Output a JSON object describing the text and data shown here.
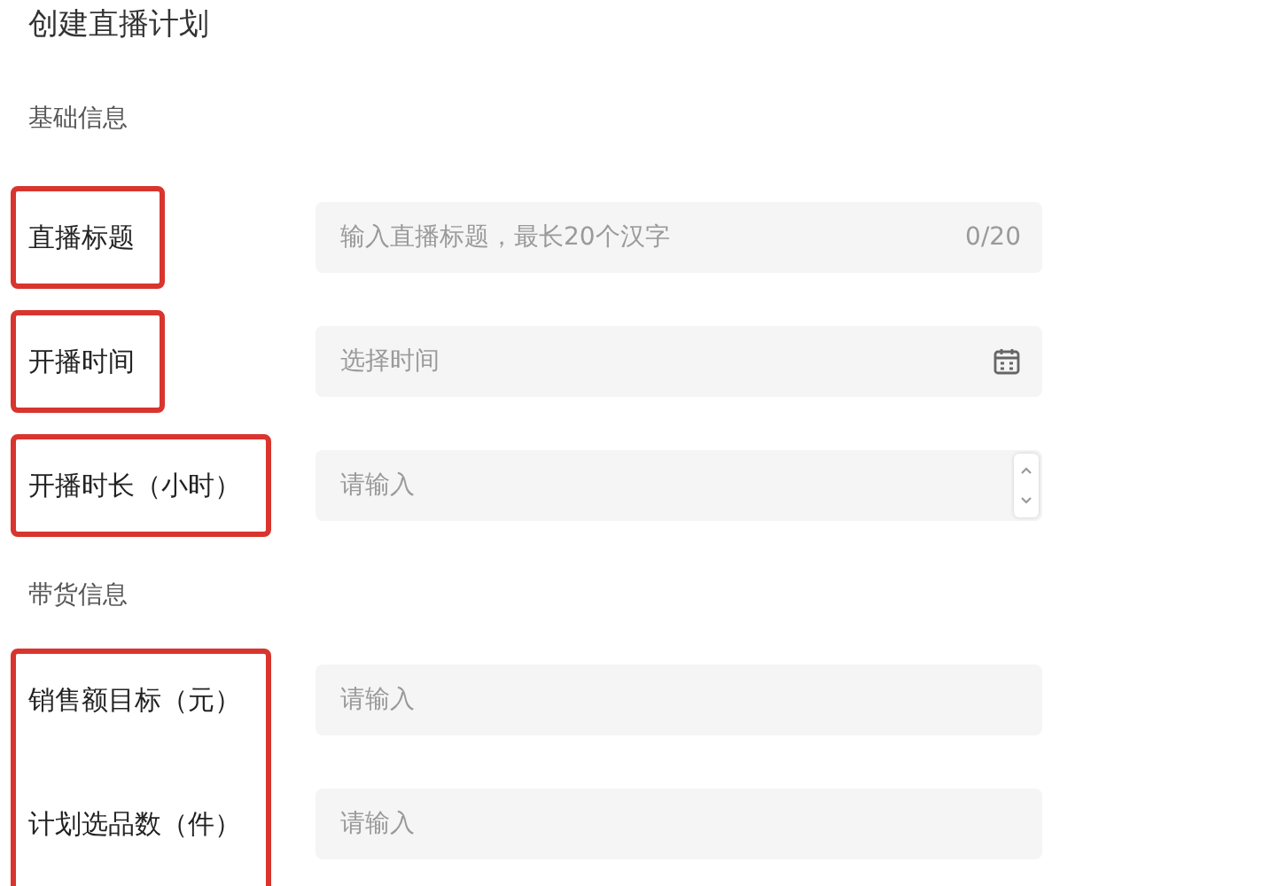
{
  "page": {
    "title": "创建直播计划"
  },
  "sections": [
    {
      "title": "基础信息",
      "groups": [
        {
          "highlighted": true,
          "fields": [
            {
              "label": "直播标题",
              "kind": "text",
              "placeholder": "输入直播标题，最长20个汉字",
              "counter": "0/20"
            }
          ]
        },
        {
          "highlighted": true,
          "fields": [
            {
              "label": "开播时间",
              "kind": "date",
              "placeholder": "选择时间"
            }
          ]
        },
        {
          "highlighted": true,
          "fields": [
            {
              "label": "开播时长（小时）",
              "kind": "number",
              "placeholder": "请输入"
            }
          ]
        }
      ]
    },
    {
      "title": "带货信息",
      "groups": [
        {
          "highlighted": true,
          "fields": [
            {
              "label": "销售额目标（元）",
              "kind": "text",
              "placeholder": "请输入"
            },
            {
              "label": "计划选品数（件）",
              "kind": "text",
              "placeholder": "请输入"
            }
          ]
        }
      ]
    }
  ]
}
